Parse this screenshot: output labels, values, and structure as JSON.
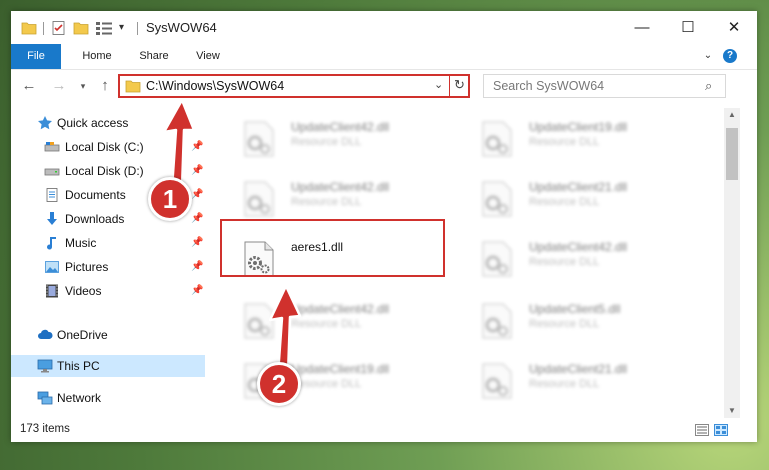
{
  "window": {
    "title": "SysWOW64",
    "controls": {
      "minimize": "—",
      "maximize": "☐",
      "close": "✕"
    },
    "quick_access_dropdown": "▾"
  },
  "ribbon": {
    "tabs": [
      "File",
      "Home",
      "Share",
      "View"
    ],
    "expand_glyph": "⌄",
    "help_glyph": "?"
  },
  "nav": {
    "back_glyph": "←",
    "forward_glyph": "→",
    "recent_glyph": "▾",
    "up_glyph": "↑",
    "address": "C:\\Windows\\SysWOW64",
    "address_dropdown": "⌄",
    "refresh_glyph": "↻",
    "search_placeholder": "Search SysWOW64",
    "search_glyph": "⌕"
  },
  "sidebar": {
    "pin_glyph": "📌",
    "items": [
      {
        "label": "Quick access",
        "icon": "star-icon"
      },
      {
        "label": "Local Disk (C:)",
        "icon": "drive-icon",
        "pinned": true
      },
      {
        "label": "Local Disk (D:)",
        "icon": "drive-icon",
        "pinned": true
      },
      {
        "label": "Documents",
        "icon": "documents-icon",
        "pinned": true
      },
      {
        "label": "Downloads",
        "icon": "download-icon",
        "pinned": true
      },
      {
        "label": "Music",
        "icon": "music-icon",
        "pinned": true
      },
      {
        "label": "Pictures",
        "icon": "pictures-icon",
        "pinned": true
      },
      {
        "label": "Videos",
        "icon": "videos-icon",
        "pinned": true
      },
      {
        "label": "OneDrive",
        "icon": "cloud-icon"
      },
      {
        "label": "This PC",
        "icon": "computer-icon",
        "selected": true
      },
      {
        "label": "Network",
        "icon": "network-icon"
      }
    ]
  },
  "files": [
    {
      "name": "UpdateClient42.dll",
      "type": "Resource DLL"
    },
    {
      "name": "UpdateClient19.dll",
      "type": "Resource DLL"
    },
    {
      "name": "UpdateClient42.dll",
      "type": "Resource DLL"
    },
    {
      "name": "UpdateClient21.dll",
      "type": "Resource DLL"
    },
    {
      "name": "aeres1.dll",
      "type": ""
    },
    {
      "name": "UpdateClient42.dll",
      "type": "Resource DLL"
    },
    {
      "name": "UpdateClient42.dll",
      "type": "Resource DLL"
    },
    {
      "name": "UpdateClient5.dll",
      "type": "Resource DLL"
    },
    {
      "name": "UpdateClient19.dll",
      "type": "Resource DLL"
    },
    {
      "name": "UpdateClient21.dll",
      "type": "Resource DLL"
    }
  ],
  "scrollbar": {
    "up_glyph": "▲",
    "down_glyph": "▼"
  },
  "status": {
    "item_count": "173 items"
  },
  "callouts": {
    "step1": "1",
    "step2": "2"
  },
  "colors": {
    "accent": "#1979ca",
    "highlight": "#d0312d",
    "selected": "#cce8ff"
  }
}
